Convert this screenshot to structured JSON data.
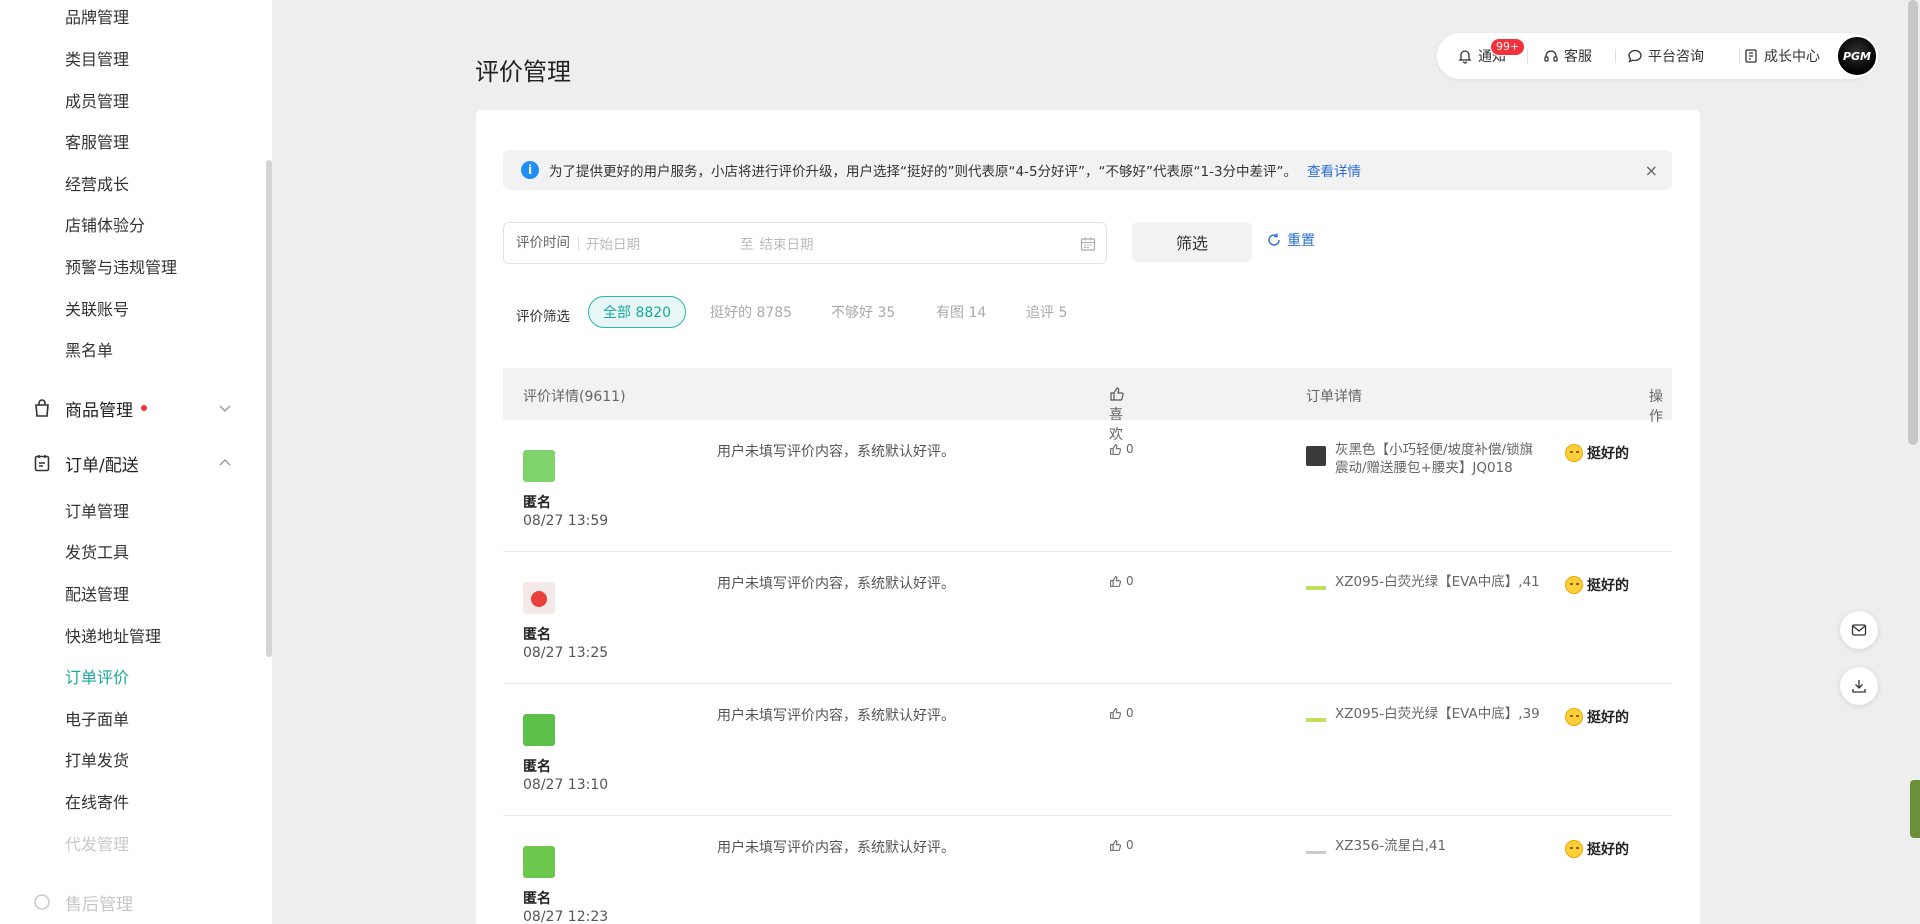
{
  "sidebar": {
    "items_top": [
      "品牌管理",
      "类目管理",
      "成员管理",
      "客服管理",
      "经营成长",
      "店铺体验分",
      "预警与违规管理",
      "关联账号",
      "黑名单"
    ],
    "group_goods": {
      "label": "商品管理",
      "icon": "shopping-bag-icon",
      "has_dot": true,
      "expanded": false
    },
    "group_orders": {
      "label": "订单/配送",
      "icon": "clipboard-icon",
      "expanded": true
    },
    "items_orders": [
      "订单管理",
      "发货工具",
      "配送管理",
      "快递地址管理",
      "订单评价",
      "电子面单",
      "打单发货",
      "在线寄件",
      "代发管理"
    ],
    "active_item": "订单评价",
    "group_aftersale": {
      "label": "售后管理"
    }
  },
  "header": {
    "title": "评价管理",
    "notify_label": "通知",
    "notify_badge": "99+",
    "service_label": "客服",
    "consult_label": "平台咨询",
    "growth_label": "成长中心",
    "avatar_text": "PGM"
  },
  "notice": {
    "text": "为了提供更好的用户服务，小店将进行评价升级，用户选择“挺好的”则代表原“4-5分好评”，“不够好”代表原“1-3分中差评”。",
    "link": "查看详情",
    "close": "×"
  },
  "filter": {
    "date_label": "评价时间",
    "start_placeholder": "开始日期",
    "sep": "至",
    "end_placeholder": "结束日期",
    "filter_button": "筛选",
    "reset_button": "重置"
  },
  "chips": {
    "label": "评价筛选",
    "items": [
      "全部 8820",
      "挺好的 8785",
      "不够好 35",
      "有图 14",
      "追评 5"
    ],
    "active_index": 0
  },
  "table": {
    "headers": {
      "detail": "评价详情(9611)",
      "like": "喜欢",
      "order": "订单详情",
      "action": "操作"
    },
    "rows": [
      {
        "name": "匿名",
        "time": "08/27 13:59",
        "content": "用户未填写评价内容，系统默认好评。",
        "likes": "0",
        "product": "灰黑色【小巧轻便/坡度补偿/锁旗震动/赠送腰包+腰夹】JQ018",
        "rating": "挺好的",
        "avatar_color": "#7fd36a"
      },
      {
        "name": "匿名",
        "time": "08/27 13:25",
        "content": "用户未填写评价内容，系统默认好评。",
        "likes": "0",
        "product": "XZ095-白荧光绿【EVA中底】,41",
        "rating": "挺好的",
        "avatar_color": "#e8403a"
      },
      {
        "name": "匿名",
        "time": "08/27 13:10",
        "content": "用户未填写评价内容，系统默认好评。",
        "likes": "0",
        "product": "XZ095-白荧光绿【EVA中底】,39",
        "rating": "挺好的",
        "avatar_color": "#5cc04a"
      },
      {
        "name": "匿名",
        "time": "08/27 12:23",
        "content": "用户未填写评价内容，系统默认好评。",
        "likes": "0",
        "product": "XZ356-流星白,41",
        "rating": "挺好的",
        "avatar_color": "#6cc84c"
      }
    ]
  },
  "colors": {
    "accent": "#1aa89b",
    "link": "#2a6fd6",
    "badge": "#f5303b"
  }
}
